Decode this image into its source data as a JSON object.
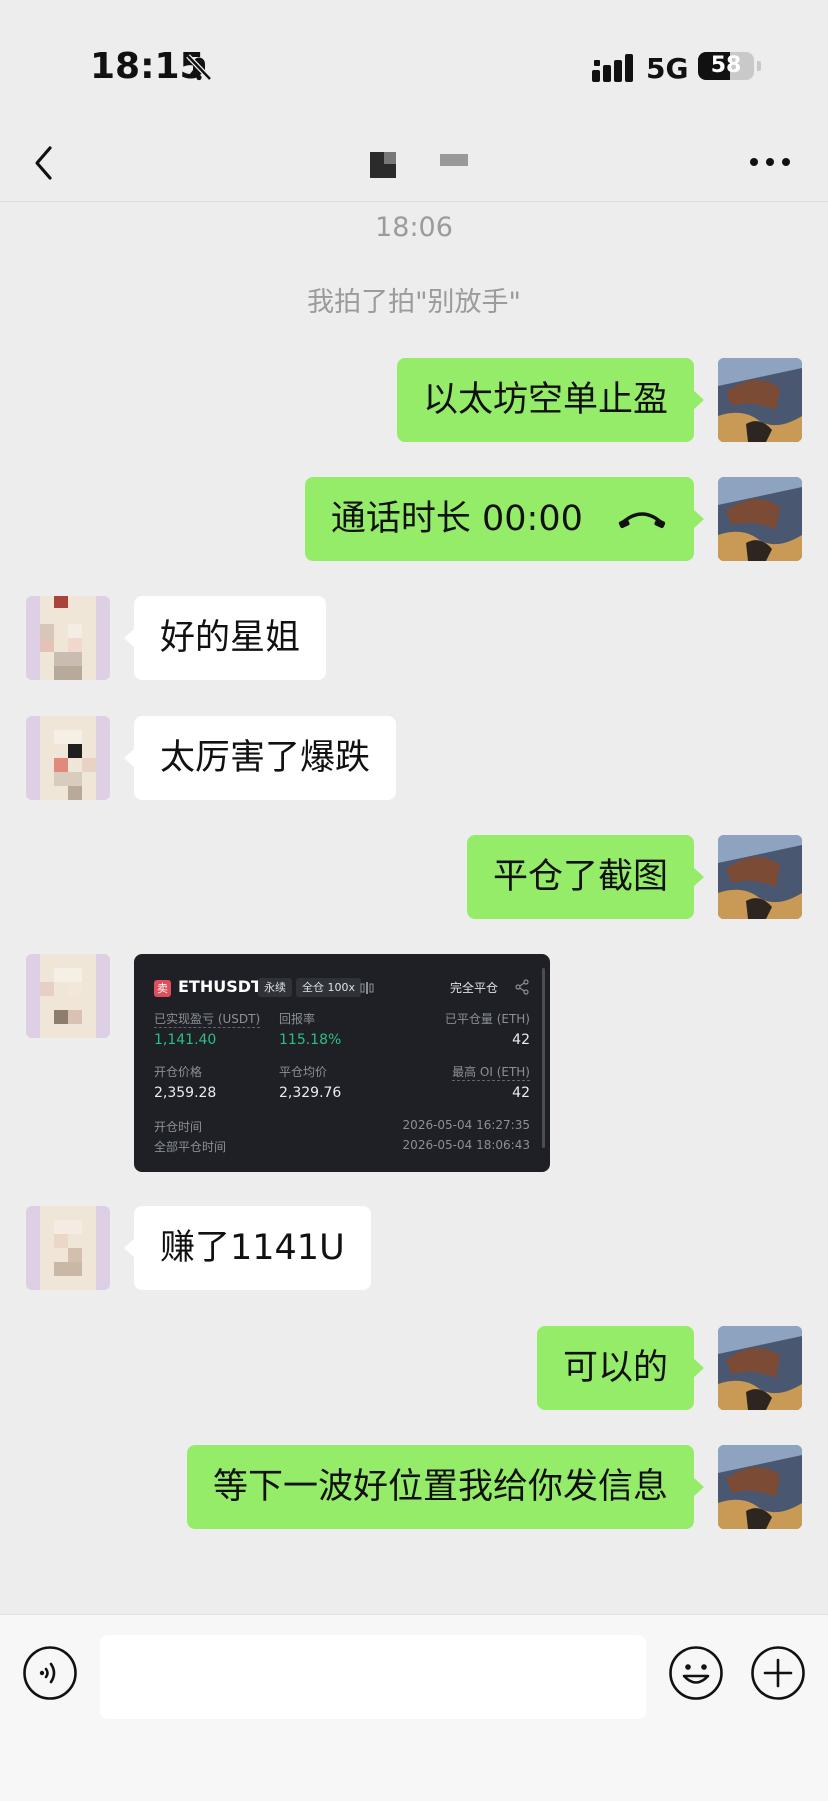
{
  "status_bar": {
    "time": "18:15",
    "network": "5G",
    "battery": "58",
    "battery_level_percent": 58,
    "icons": [
      "bell-off-icon",
      "signal-icon",
      "battery-icon"
    ]
  },
  "nav": {
    "icons": [
      "back-chevron-icon",
      "more-dots-icon"
    ]
  },
  "chat": {
    "time_separator": "18:06",
    "system_message": "我拍了拍\"别放手\"",
    "messages": [
      {
        "side": "out",
        "text": "以太坊空单止盈"
      },
      {
        "side": "out",
        "text": "通话时长 00:00",
        "icon": "phone-hangup-icon"
      },
      {
        "side": "in",
        "text": "好的星姐"
      },
      {
        "side": "in",
        "text": "太厉害了爆跌"
      },
      {
        "side": "out",
        "text": "平仓了截图"
      },
      {
        "side": "in",
        "type": "image",
        "content": "trade_card"
      },
      {
        "side": "in",
        "text": "赚了1141U"
      },
      {
        "side": "out",
        "text": "可以的"
      },
      {
        "side": "out",
        "text": "等下一波好位置我给你发信息"
      }
    ]
  },
  "trade_card": {
    "side_badge": "卖",
    "symbol": "ETHUSDT",
    "tag_perpetual": "永续",
    "tag_margin": "全仓 100x",
    "close_type": "完全平仓",
    "realized_pnl_label": "已实现盈亏 (USDT)",
    "realized_pnl_value": "1,141.40",
    "roi_label": "回报率",
    "roi_value": "115.18%",
    "closed_qty_label": "已平仓量 (ETH)",
    "closed_qty_value": "42",
    "open_price_label": "开仓价格",
    "open_price_value": "2,359.28",
    "close_avg_label": "平仓均价",
    "close_avg_value": "2,329.76",
    "max_oi_label": "最高 OI (ETH)",
    "max_oi_value": "42",
    "open_time_label": "开仓时间",
    "open_time_value": "2026-05-04 16:27:35",
    "close_time_label": "全部平仓时间",
    "close_time_value": "2026-05-04 18:06:43",
    "colors": {
      "green": "#2ebd85",
      "sell": "#e14e5a",
      "background": "#1e2026"
    }
  },
  "input_bar": {
    "message_value": "",
    "icons": [
      "voice-icon",
      "emoji-icon",
      "plus-icon"
    ]
  },
  "colors": {
    "outgoing_bubble": "#95ec69",
    "incoming_bubble": "#ffffff",
    "chat_background": "#ededed"
  }
}
